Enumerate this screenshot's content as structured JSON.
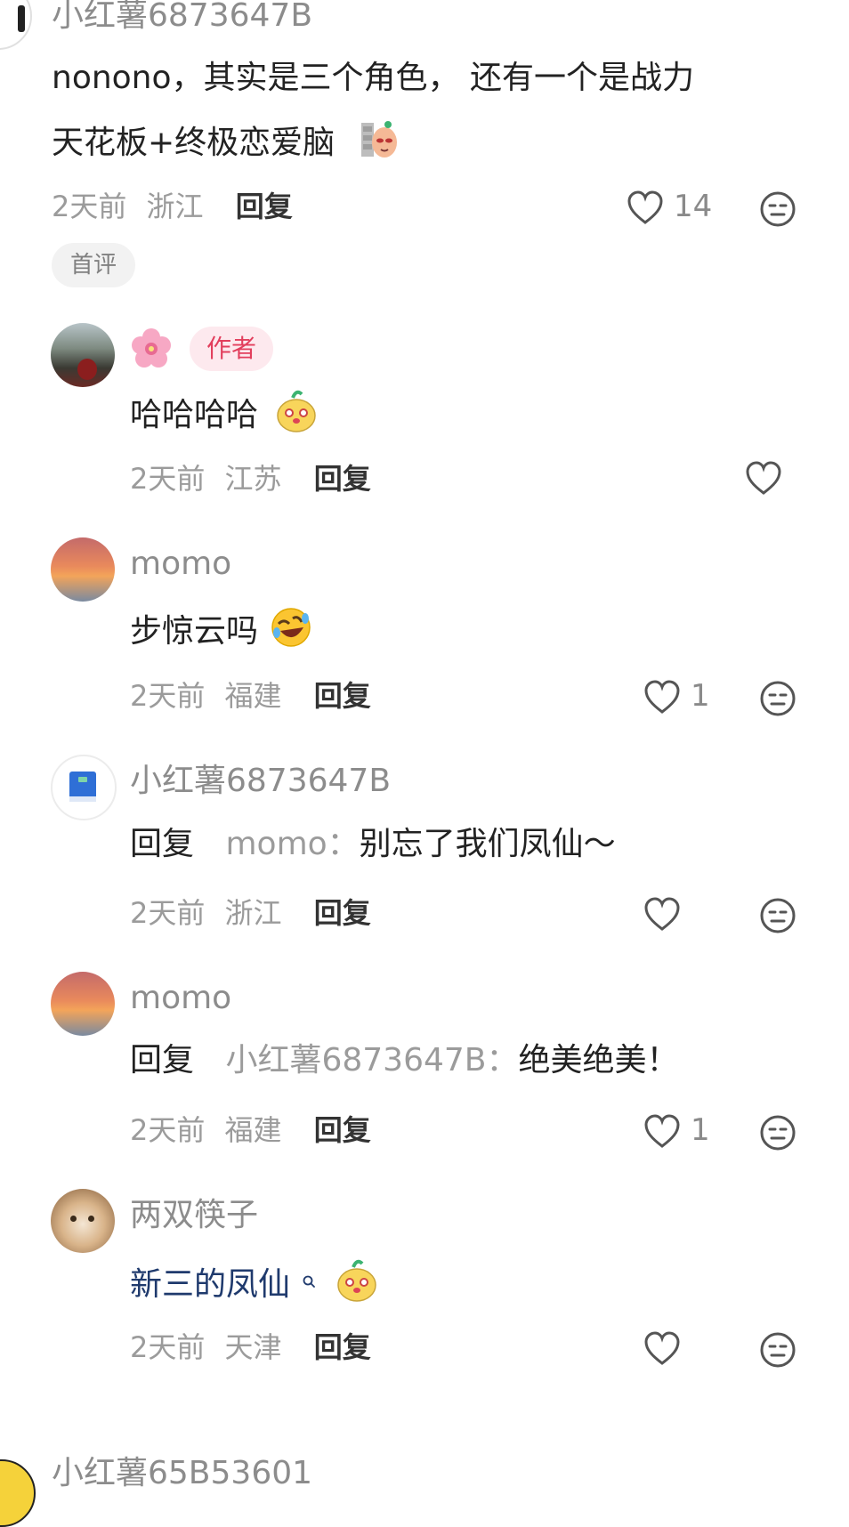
{
  "comments": [
    {
      "nickname": "小红薯6873647B",
      "text": "nonono，其实是三个角色， 还有一个是战力",
      "text2": "天花板+终极恋爱脑",
      "time": "2天前",
      "location": "浙江",
      "reply_label": "回复",
      "likes": "14",
      "badge": "首评"
    },
    {
      "author_badge": "作者",
      "text": "哈哈哈哈",
      "time": "2天前",
      "location": "江苏",
      "reply_label": "回复"
    },
    {
      "nickname": "momo",
      "text": "步惊云吗",
      "time": "2天前",
      "location": "福建",
      "reply_label": "回复",
      "likes": "1"
    },
    {
      "nickname": "小红薯6873647B",
      "reply_prefix": "回复",
      "reply_to": "momo",
      "colon": "：",
      "text": "别忘了我们凤仙～",
      "time": "2天前",
      "location": "浙江",
      "reply_label": "回复"
    },
    {
      "nickname": "momo",
      "reply_prefix": "回复",
      "reply_to": "小红薯6873647B",
      "colon": "：",
      "text": "绝美绝美！",
      "time": "2天前",
      "location": "福建",
      "reply_label": "回复",
      "likes": "1"
    },
    {
      "nickname": "两双筷子",
      "text": "新三的凤仙",
      "time": "2天前",
      "location": "天津",
      "reply_label": "回复"
    },
    {
      "nickname": "小红薯65B53601"
    }
  ],
  "colors": {
    "author_badge": "#e23f5d",
    "link": "#1f3a6d",
    "meta": "#9b9b9b"
  },
  "icons": [
    "heart-icon",
    "dislike-face-icon",
    "search-link-icon",
    "sticker-emoji",
    "rofl-emoji",
    "flower-emoji",
    "book-icon"
  ]
}
